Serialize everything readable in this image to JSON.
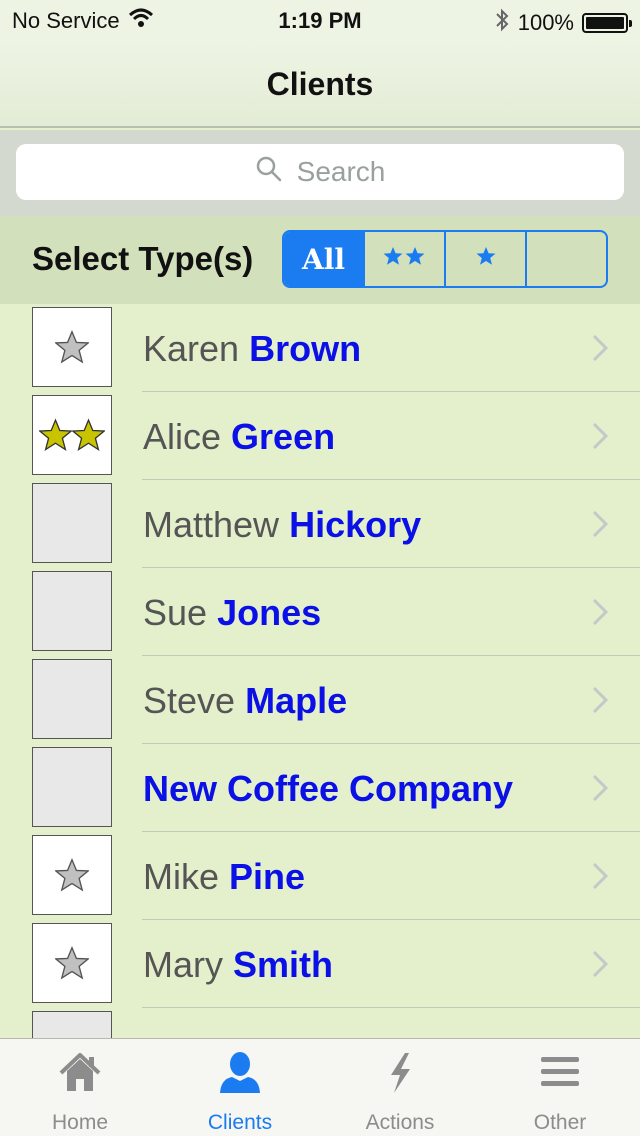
{
  "status": {
    "carrier": "No Service",
    "time": "1:19 PM",
    "battery": "100%"
  },
  "nav": {
    "title": "Clients"
  },
  "search": {
    "placeholder": "Search"
  },
  "filter": {
    "label": "Select Type(s)",
    "options": [
      "All",
      "★★",
      "★",
      ""
    ],
    "selected": "All"
  },
  "clients": [
    {
      "first": "Karen",
      "last": "Brown",
      "stars": 1
    },
    {
      "first": "Alice",
      "last": "Green",
      "stars": 2
    },
    {
      "first": "Matthew",
      "last": "Hickory",
      "stars": 0
    },
    {
      "first": "Sue",
      "last": "Jones",
      "stars": 0
    },
    {
      "first": "Steve",
      "last": "Maple",
      "stars": 0
    },
    {
      "first": "",
      "last": "New Coffee Company",
      "stars": 0
    },
    {
      "first": "Mike",
      "last": "Pine",
      "stars": 1
    },
    {
      "first": "Mary",
      "last": "Smith",
      "stars": 1
    }
  ],
  "tabs": [
    {
      "label": "Home",
      "icon": "home-icon"
    },
    {
      "label": "Clients",
      "icon": "person-icon"
    },
    {
      "label": "Actions",
      "icon": "lightning-icon"
    },
    {
      "label": "Other",
      "icon": "menu-icon"
    }
  ],
  "active_tab": "Clients",
  "colors": {
    "accent": "#1a7cf0",
    "last_name": "#0a10e6",
    "background": "#e4f0cc",
    "star_gold": "#c8c400",
    "star_gray": "#c0c0c0"
  }
}
